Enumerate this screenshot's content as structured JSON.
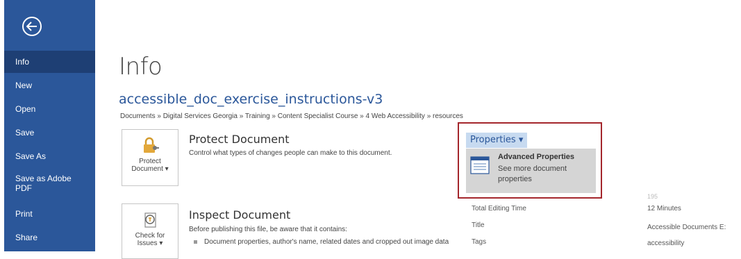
{
  "sidebar": {
    "items": [
      {
        "label": "Info",
        "active": true
      },
      {
        "label": "New"
      },
      {
        "label": "Open"
      },
      {
        "label": "Save"
      },
      {
        "label": "Save As"
      },
      {
        "label": "Save as Adobe PDF"
      },
      {
        "label": "Print"
      },
      {
        "label": "Share"
      }
    ]
  },
  "page": {
    "title": "Info",
    "doc_title": "accessible_doc_exercise_instructions-v3",
    "breadcrumb": "Documents » Digital Services Georgia » Training » Content Specialist Course » 4 Web Accessibility » resources"
  },
  "protect": {
    "tile_line1": "Protect",
    "tile_line2": "Document ▾",
    "heading": "Protect Document",
    "description": "Control what types of changes people can make to this document."
  },
  "inspect": {
    "tile_line1": "Check for",
    "tile_line2": "Issues ▾",
    "heading": "Inspect Document",
    "description": "Before publishing this file, be aware that it contains:",
    "bullet": "Document properties, author's name, related dates and cropped out image data"
  },
  "properties": {
    "button_label": "Properties ▾",
    "menu": {
      "title": "Advanced Properties",
      "desc_line1": "See more document",
      "desc_line2": "properties"
    },
    "partial_value": "195",
    "rows": [
      {
        "label": "Total Editing Time",
        "value": "12 Minutes"
      },
      {
        "label": "Title",
        "value": "Accessible Documents E:"
      },
      {
        "label": "Tags",
        "value": "accessibility"
      }
    ]
  },
  "colors": {
    "sidebar": "#2b579a",
    "sidebar_active": "#1e3f74",
    "highlight_border": "#a4262c"
  }
}
